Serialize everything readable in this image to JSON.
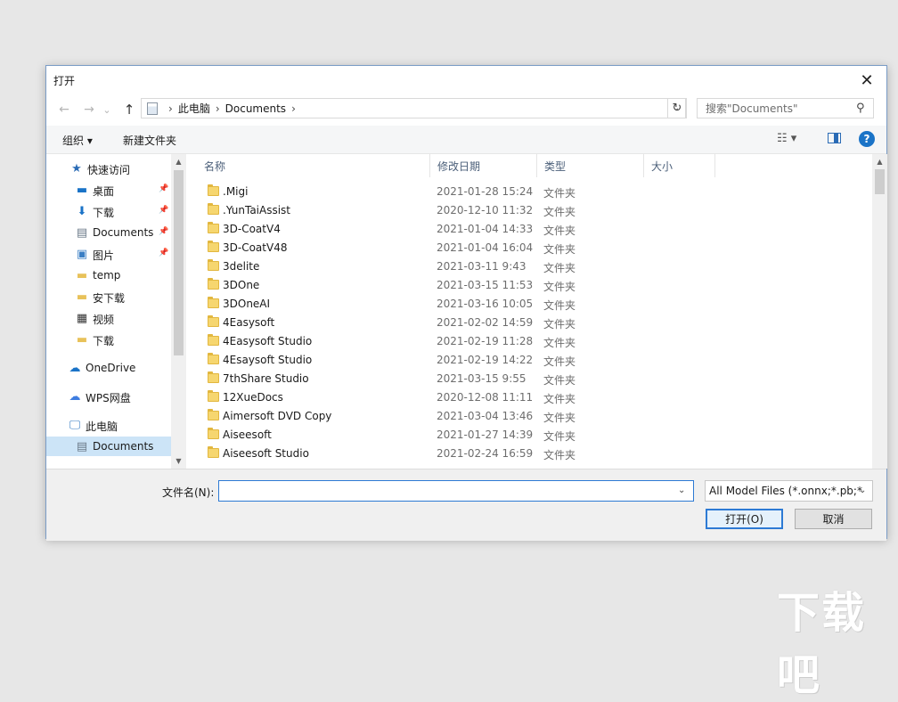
{
  "dialog": {
    "title": "打开",
    "close_glyph": "✕"
  },
  "nav": {
    "back_glyph": "←",
    "forward_glyph": "→",
    "recent_glyph": "⌄",
    "up_glyph": "↑"
  },
  "address": {
    "crumbs": [
      "此电脑",
      "Documents"
    ],
    "sep": "›",
    "drop_glyph": "⌄",
    "refresh_glyph": "↻"
  },
  "search": {
    "placeholder": "搜索\"Documents\"",
    "icon_glyph": "⚲"
  },
  "toolbar": {
    "organize": "组织 ▾",
    "new_folder": "新建文件夹",
    "view_glyph": "☷ ▾",
    "help_glyph": "?"
  },
  "sidebar": {
    "items": [
      {
        "label": "快速访问",
        "icon": "star-icon",
        "glyph": "★",
        "color": "#2a6bb5"
      },
      {
        "label": "桌面",
        "icon": "desktop-icon",
        "glyph": "▬",
        "color": "#1a73c7",
        "pin": "📌"
      },
      {
        "label": "下载",
        "icon": "download-icon",
        "glyph": "⬇",
        "color": "#1a73c7",
        "pin": "📌"
      },
      {
        "label": "Documents",
        "icon": "document-icon",
        "glyph": "▤",
        "color": "#6b7a89",
        "pin": "📌"
      },
      {
        "label": "图片",
        "icon": "pictures-icon",
        "glyph": "▣",
        "color": "#3b7fc4",
        "pin": "📌"
      },
      {
        "label": "temp",
        "icon": "folder-icon",
        "glyph": "▬",
        "color": "#e8c25a"
      },
      {
        "label": "安下载",
        "icon": "folder-icon",
        "glyph": "▬",
        "color": "#e8c25a"
      },
      {
        "label": "视频",
        "icon": "video-icon",
        "glyph": "▦",
        "color": "#333333"
      },
      {
        "label": "下载",
        "icon": "folder-icon",
        "glyph": "▬",
        "color": "#e8c25a"
      },
      {
        "label": "OneDrive",
        "icon": "cloud-icon",
        "glyph": "☁",
        "color": "#1a73c7"
      },
      {
        "label": "WPS网盘",
        "icon": "cloud-icon",
        "glyph": "☁",
        "color": "#3d7ce0"
      },
      {
        "label": "此电脑",
        "icon": "computer-icon",
        "glyph": "🖵",
        "color": "#3b7fc4"
      },
      {
        "label": "Documents",
        "icon": "document-icon",
        "glyph": "▤",
        "color": "#6b7a89",
        "selected": true
      }
    ]
  },
  "columns": {
    "name": "名称",
    "date": "修改日期",
    "type": "类型",
    "size": "大小",
    "sort_glyph": "^"
  },
  "files": [
    {
      "name": ".Migi",
      "date": "2021-01-28 15:24",
      "type": "文件夹"
    },
    {
      "name": ".YunTaiAssist",
      "date": "2020-12-10 11:32",
      "type": "文件夹"
    },
    {
      "name": "3D-CoatV4",
      "date": "2021-01-04 14:33",
      "type": "文件夹"
    },
    {
      "name": "3D-CoatV48",
      "date": "2021-01-04 16:04",
      "type": "文件夹"
    },
    {
      "name": "3delite",
      "date": "2021-03-11 9:43",
      "type": "文件夹"
    },
    {
      "name": "3DOne",
      "date": "2021-03-15 11:53",
      "type": "文件夹"
    },
    {
      "name": "3DOneAI",
      "date": "2021-03-16 10:05",
      "type": "文件夹"
    },
    {
      "name": "4Easysoft",
      "date": "2021-02-02 14:59",
      "type": "文件夹"
    },
    {
      "name": "4Easysoft Studio",
      "date": "2021-02-19 11:28",
      "type": "文件夹"
    },
    {
      "name": "4Esaysoft Studio",
      "date": "2021-02-19 14:22",
      "type": "文件夹"
    },
    {
      "name": "7thShare Studio",
      "date": "2021-03-15 9:55",
      "type": "文件夹"
    },
    {
      "name": "12XueDocs",
      "date": "2020-12-08 11:11",
      "type": "文件夹"
    },
    {
      "name": "Aimersoft DVD Copy",
      "date": "2021-03-04 13:46",
      "type": "文件夹"
    },
    {
      "name": "Aiseesoft",
      "date": "2021-01-27 14:39",
      "type": "文件夹"
    },
    {
      "name": "Aiseesoft Studio",
      "date": "2021-02-24 16:59",
      "type": "文件夹"
    }
  ],
  "scroll": {
    "up_glyph": "▲",
    "down_glyph": "▼"
  },
  "bottom": {
    "filename_label": "文件名(N):",
    "filename_value": "",
    "filename_drop": "⌄",
    "filter_value": "All Model Files (*.onnx;*.pb;*",
    "filter_drop": "⌄",
    "open_label": "打开(O)",
    "cancel_label": "取消"
  },
  "watermark": "下载吧"
}
